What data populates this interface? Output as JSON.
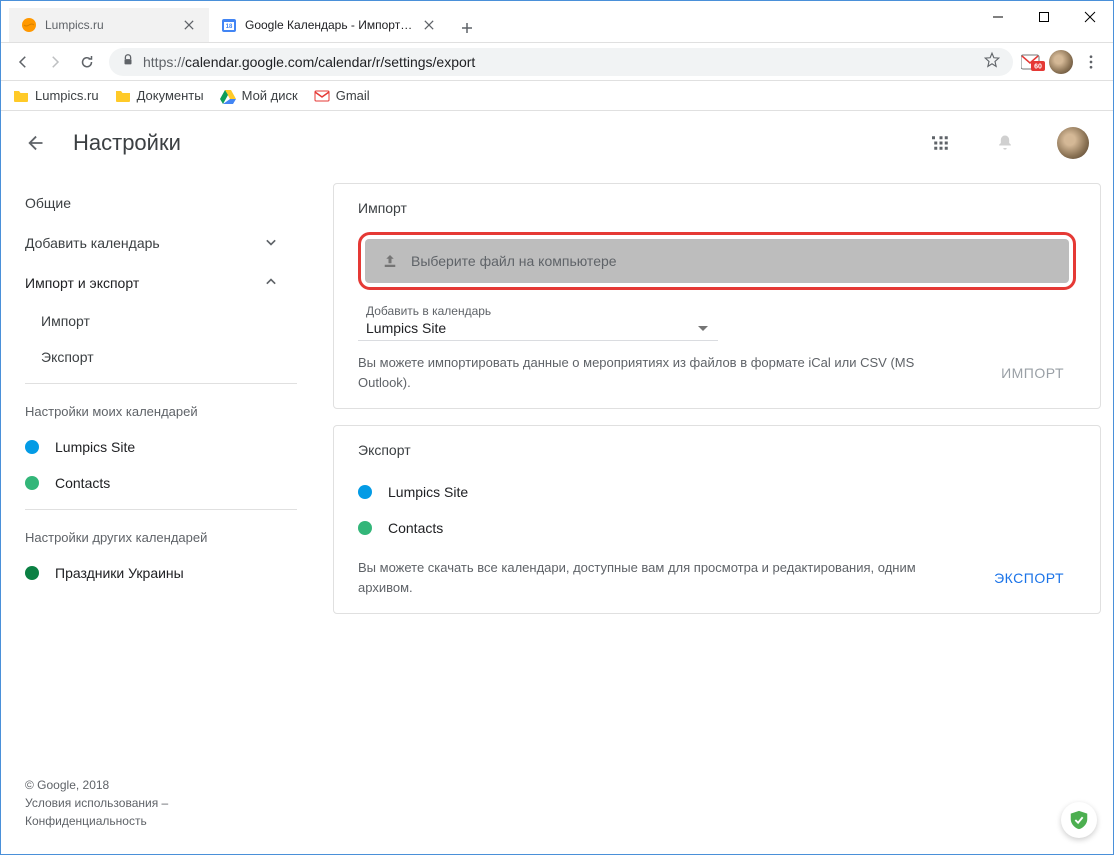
{
  "browser": {
    "tabs": [
      {
        "title": "Lumpics.ru",
        "active": false
      },
      {
        "title": "Google Календарь - Импорт и э",
        "active": true
      }
    ],
    "url_proto": "https://",
    "url_path": "calendar.google.com/calendar/r/settings/export",
    "bookmarks": [
      {
        "label": "Lumpics.ru"
      },
      {
        "label": "Документы"
      },
      {
        "label": "Мой диск"
      },
      {
        "label": "Gmail"
      }
    ],
    "gmail_count": "60"
  },
  "header": {
    "title": "Настройки"
  },
  "sidebar": {
    "items": [
      {
        "label": "Общие",
        "expandable": false
      },
      {
        "label": "Добавить календарь",
        "expandable": true,
        "expanded": false
      },
      {
        "label": "Импорт и экспорт",
        "expandable": true,
        "expanded": true,
        "bold": true,
        "children": [
          {
            "label": "Импорт"
          },
          {
            "label": "Экспорт"
          }
        ]
      }
    ],
    "my_calendars_title": "Настройки моих календарей",
    "my_calendars": [
      {
        "label": "Lumpics Site",
        "color": "#039be5"
      },
      {
        "label": "Contacts",
        "color": "#33b679"
      }
    ],
    "other_calendars_title": "Настройки других календарей",
    "other_calendars": [
      {
        "label": "Праздники Украины",
        "color": "#0b8043"
      }
    ],
    "footer": {
      "copyright": "© Google, 2018",
      "terms": "Условия использования",
      "privacy": "Конфиденциальность"
    }
  },
  "import_panel": {
    "title": "Импорт",
    "upload_label": "Выберите файл на компьютере",
    "select_label": "Добавить в календарь",
    "select_value": "Lumpics Site",
    "help": "Вы можете импортировать данные о мероприятиях из файлов в формате iCal или CSV (MS Outlook).",
    "action": "ИМПОРТ"
  },
  "export_panel": {
    "title": "Экспорт",
    "calendars": [
      {
        "label": "Lumpics Site",
        "color": "#039be5"
      },
      {
        "label": "Contacts",
        "color": "#33b679"
      }
    ],
    "help": "Вы можете скачать все календари, доступные вам для просмотра и редактирования, одним архивом.",
    "action": "ЭКСПОРТ"
  }
}
